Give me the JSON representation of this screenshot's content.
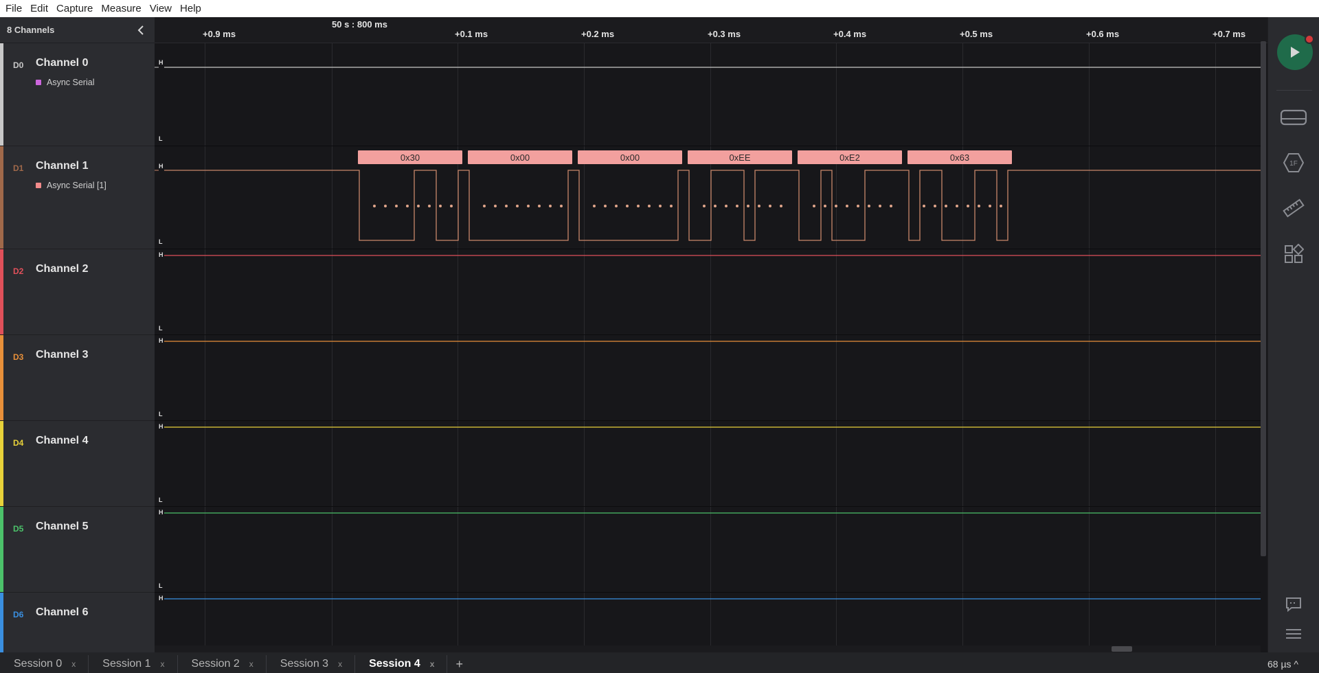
{
  "menu": [
    "File",
    "Edit",
    "Capture",
    "Measure",
    "View",
    "Help"
  ],
  "sidebar": {
    "header": "8 Channels"
  },
  "channels": [
    {
      "id": "D0",
      "name": "Channel 0",
      "color": "#c8c8c8",
      "analyzer": "Async Serial",
      "analyzer_color": "#cc66dd"
    },
    {
      "id": "D1",
      "name": "Channel 1",
      "color": "#a0694a",
      "analyzer": "Async Serial [1]",
      "analyzer_color": "#f28b8b"
    },
    {
      "id": "D2",
      "name": "Channel 2",
      "color": "#e0505a",
      "analyzer": "",
      "analyzer_color": ""
    },
    {
      "id": "D3",
      "name": "Channel 3",
      "color": "#e8903a",
      "analyzer": "",
      "analyzer_color": ""
    },
    {
      "id": "D4",
      "name": "Channel 4",
      "color": "#e8d23a",
      "analyzer": "",
      "analyzer_color": ""
    },
    {
      "id": "D5",
      "name": "Channel 5",
      "color": "#4cc26a",
      "analyzer": "",
      "analyzer_color": ""
    },
    {
      "id": "D6",
      "name": "Channel 6",
      "color": "#3a8fe0",
      "analyzer": "",
      "analyzer_color": ""
    }
  ],
  "timeline": {
    "timestamp": "50 s : 800 ms",
    "ticks": [
      "+0.9 ms",
      "+0.1 ms",
      "+0.2 ms",
      "+0.3 ms",
      "+0.4 ms",
      "+0.5 ms",
      "+0.6 ms",
      "+0.7 ms"
    ]
  },
  "levels": {
    "high": "H",
    "low": "L"
  },
  "decoded_bytes": [
    "0x30",
    "0x00",
    "0x00",
    "0xEE",
    "0xE2",
    "0x63"
  ],
  "sessions": [
    {
      "label": "Session 0",
      "active": false
    },
    {
      "label": "Session 1",
      "active": false
    },
    {
      "label": "Session 2",
      "active": false
    },
    {
      "label": "Session 3",
      "active": false
    },
    {
      "label": "Session 4",
      "active": true
    }
  ],
  "tab_close": "x",
  "tab_add": "+",
  "zoom": "68 µs ^",
  "icons": {
    "collapse": "chevron-left-icon",
    "play": "play-icon",
    "device": "device-icon",
    "trigger": "trigger-icon",
    "measure": "ruler-icon",
    "extensions": "extensions-icon",
    "chat": "chat-icon",
    "menu": "hamburger-icon"
  }
}
